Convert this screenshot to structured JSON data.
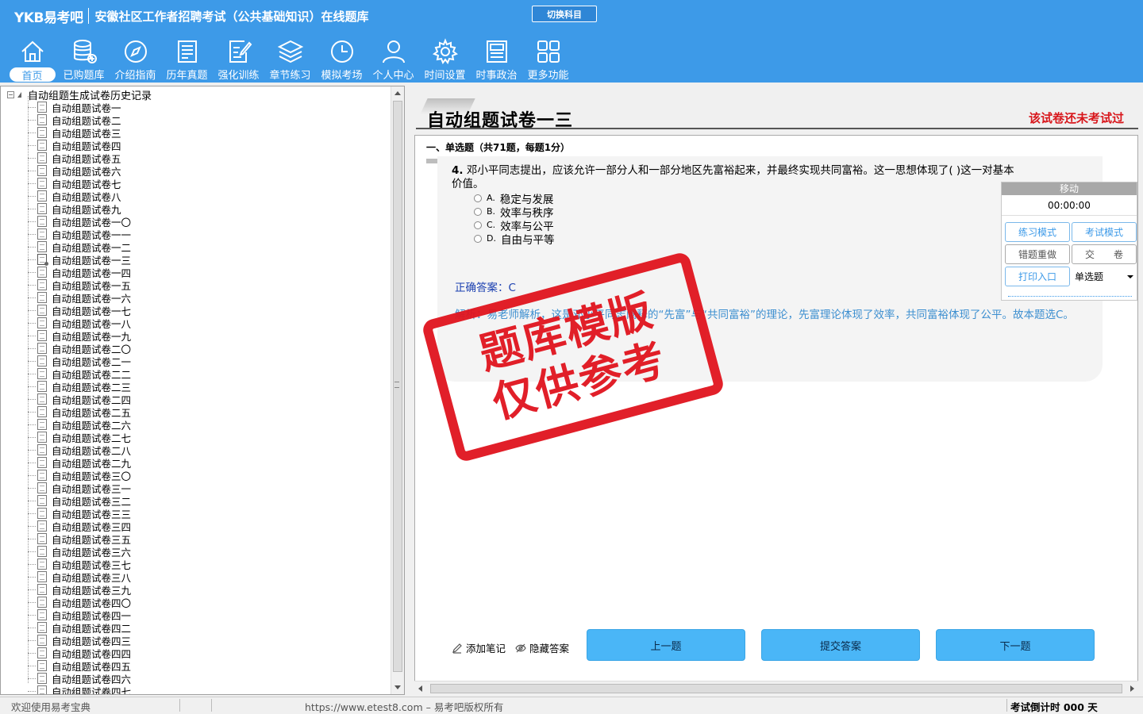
{
  "header": {
    "logo": "YKB易考吧",
    "title": "安徽社区工作者招聘考试（公共基础知识）在线题库",
    "switch_subject": "切换科目"
  },
  "nav": [
    {
      "label": "首页",
      "icon": "home-icon",
      "active": true
    },
    {
      "label": "已购题库",
      "icon": "database-icon"
    },
    {
      "label": "介绍指南",
      "icon": "compass-icon"
    },
    {
      "label": "历年真题",
      "icon": "list-doc-icon"
    },
    {
      "label": "强化训练",
      "icon": "edit-doc-icon"
    },
    {
      "label": "章节练习",
      "icon": "layers-icon"
    },
    {
      "label": "模拟考场",
      "icon": "clock-icon"
    },
    {
      "label": "个人中心",
      "icon": "user-icon"
    },
    {
      "label": "时间设置",
      "icon": "gear-icon"
    },
    {
      "label": "时事政治",
      "icon": "newspaper-icon"
    },
    {
      "label": "更多功能",
      "icon": "grid-icon"
    }
  ],
  "tree": {
    "root": "自动组题生成试卷历史记录",
    "items": [
      "自动组题试卷一",
      "自动组题试卷二",
      "自动组题试卷三",
      "自动组题试卷四",
      "自动组题试卷五",
      "自动组题试卷六",
      "自动组题试卷七",
      "自动组题试卷八",
      "自动组题试卷九",
      "自动组题试卷一〇",
      "自动组题试卷一一",
      "自动组题试卷一二",
      "自动组题试卷一三",
      "自动组题试卷一四",
      "自动组题试卷一五",
      "自动组题试卷一六",
      "自动组题试卷一七",
      "自动组题试卷一八",
      "自动组题试卷一九",
      "自动组题试卷二〇",
      "自动组题试卷二一",
      "自动组题试卷二二",
      "自动组题试卷二三",
      "自动组题试卷二四",
      "自动组题试卷二五",
      "自动组题试卷二六",
      "自动组题试卷二七",
      "自动组题试卷二八",
      "自动组题试卷二九",
      "自动组题试卷三〇",
      "自动组题试卷三一",
      "自动组题试卷三二",
      "自动组题试卷三三",
      "自动组题试卷三四",
      "自动组题试卷三五",
      "自动组题试卷三六",
      "自动组题试卷三七",
      "自动组题试卷三八",
      "自动组题试卷三九",
      "自动组题试卷四〇",
      "自动组题试卷四一",
      "自动组题试卷四二",
      "自动组题试卷四三",
      "自动组题试卷四四",
      "自动组题试卷四五",
      "自动组题试卷四六",
      "自动组题试卷四七"
    ],
    "active_index": 12
  },
  "paper": {
    "title": "自动组题试卷一三",
    "status": "该试卷还未考试过",
    "section": "一、单选题（共71题，每题1分）"
  },
  "question": {
    "number": "4.",
    "text": "邓小平同志提出，应该允许一部分人和一部分地区先富裕起来，并最终实现共同富裕。这一思想体现了( )这一对基本价值。",
    "options": [
      {
        "letter": "A.",
        "text": "稳定与发展"
      },
      {
        "letter": "B.",
        "text": "效率与秩序"
      },
      {
        "letter": "C.",
        "text": "效率与公平"
      },
      {
        "letter": "D.",
        "text": "自由与平等"
      }
    ],
    "answer": "正确答案：C",
    "analysis": "解析：易老师解析，这是邓小平同志阐释的“先富”与“共同富裕”的理论，先富理论体现了效率，共同富裕体现了公平。故本题选C。"
  },
  "timer": {
    "move_label": "移动",
    "time": "00:00:00",
    "practice_mode": "练习模式",
    "exam_mode": "考试模式",
    "redo_wrong": "错题重做",
    "submit_paper": "交　　卷",
    "print_entry": "打印入口",
    "question_type": "单选题"
  },
  "actions": {
    "add_note": "添加笔记",
    "hide_answer": "隐藏答案",
    "prev": "上一题",
    "submit": "提交答案",
    "next": "下一题"
  },
  "watermark": {
    "line1": "题库模版",
    "line2": "仅供参考"
  },
  "status_bar": {
    "welcome": "欢迎使用易考宝典",
    "copyright": "https://www.etest8.com – 易考吧版权所有",
    "countdown": "考试倒计时 000 天"
  }
}
